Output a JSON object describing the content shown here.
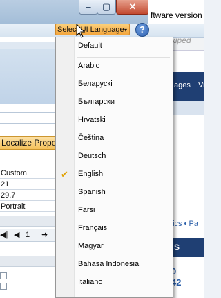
{
  "window": {
    "minimize_glyph": "–",
    "maximize_glyph": "▢",
    "close_glyph": "✕"
  },
  "toolbar": {
    "language_button_label": "Select UI Language",
    "language_button_caret": "▾",
    "help_label": "?"
  },
  "left_panel": {
    "localize_label": "Localize Proper",
    "rows": [
      "Custom",
      "21",
      "29.7",
      "Portrait"
    ],
    "pager": {
      "prev": "◀|",
      "back": "◀",
      "page": "1",
      "next": "➜"
    }
  },
  "background_browser": {
    "version_text": "ftware version",
    "search_placeholder": "Wikiped",
    "nav_items": [
      "ages",
      "Vi"
    ],
    "topics_text": "pics • Pa",
    "dark_heading": "S",
    "numbers": [
      "0",
      "42"
    ]
  },
  "menu": {
    "items": [
      {
        "label": "Default",
        "checked": false
      },
      {
        "label": "Arabic",
        "checked": false
      },
      {
        "label": "Беларускі",
        "checked": false
      },
      {
        "label": "Български",
        "checked": false
      },
      {
        "label": "Hrvatski",
        "checked": false
      },
      {
        "label": "Čeština",
        "checked": false
      },
      {
        "label": "Deutsch",
        "checked": false
      },
      {
        "label": "English",
        "checked": true
      },
      {
        "label": "Spanish",
        "checked": false
      },
      {
        "label": "Farsi",
        "checked": false
      },
      {
        "label": "Français",
        "checked": false
      },
      {
        "label": "Magyar",
        "checked": false
      },
      {
        "label": "Bahasa Indonesia",
        "checked": false
      },
      {
        "label": "Italiano",
        "checked": false
      }
    ]
  },
  "colors": {
    "accent_orange": "#f3a53c",
    "check_color": "#e0a000",
    "browser_nav": "#1f3f73"
  }
}
